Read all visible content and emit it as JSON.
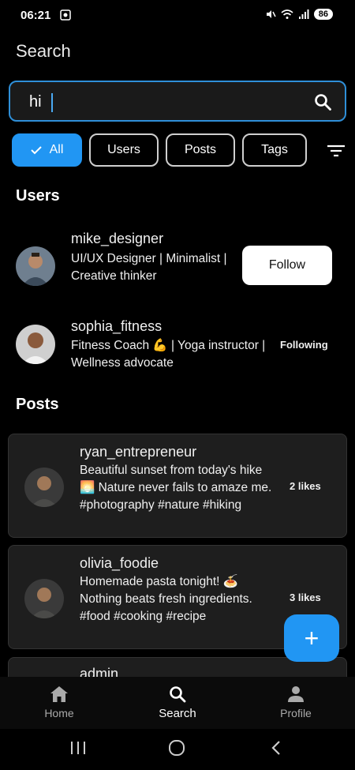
{
  "status": {
    "time": "06:21",
    "battery": "86"
  },
  "page_title": "Search",
  "search": {
    "value": "hi"
  },
  "filters": {
    "chips": [
      "All",
      "Users",
      "Posts",
      "Tags"
    ]
  },
  "users_section": {
    "title": "Users",
    "users": [
      {
        "name": "mike_designer",
        "bio": "UI/UX Designer | Minimalist | Creative thinker",
        "action": "Follow"
      },
      {
        "name": "sophia_fitness",
        "bio": "Fitness Coach 💪 | Yoga instructor | Wellness advocate",
        "action": "Following"
      }
    ]
  },
  "posts_section": {
    "title": "Posts",
    "posts": [
      {
        "author": "ryan_entrepreneur",
        "text": "Beautiful sunset from today's hike 🌅 Nature never fails to amaze me. #photography #nature #hiking",
        "likes": "2 likes"
      },
      {
        "author": "olivia_foodie",
        "text": "Homemade pasta tonight! 🍝 Nothing beats fresh ingredients. #food #cooking #recipe",
        "likes": "3 likes"
      },
      {
        "author": "admin"
      }
    ]
  },
  "fab": {
    "label": "+"
  },
  "bottom_nav": {
    "items": [
      "Home",
      "Search",
      "Profile"
    ]
  },
  "colors": {
    "accent": "#2196f3",
    "background": "#000000",
    "card": "#1e1e1e"
  }
}
